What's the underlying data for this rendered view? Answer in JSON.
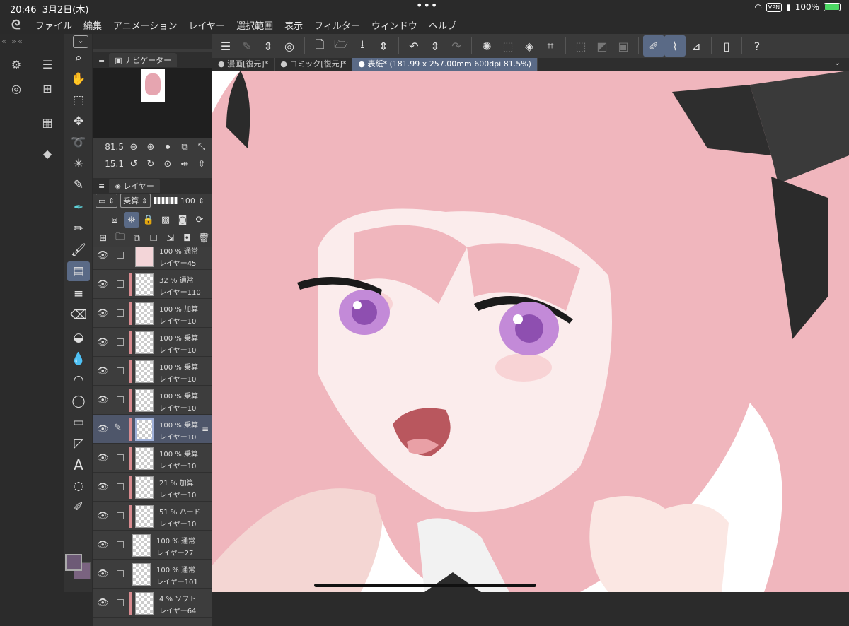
{
  "status": {
    "time": "20:46",
    "date": "3月2日(木)",
    "vpn": "VPN",
    "battery": "100%"
  },
  "menu": [
    "ファイル",
    "編集",
    "アニメーション",
    "レイヤー",
    "選択範囲",
    "表示",
    "フィルター",
    "ウィンドウ",
    "ヘルプ"
  ],
  "navigator": {
    "title": "ナビゲーター",
    "zoom": "81.5",
    "rotation": "15.1"
  },
  "layers_panel": {
    "title": "レイヤー",
    "blend_mode": "乗算",
    "opacity": "100"
  },
  "layers": [
    {
      "opacity": "100 %",
      "mode": "通常",
      "name": "レイヤー45",
      "selected": false,
      "pink": true
    },
    {
      "opacity": "32 %",
      "mode": "通常",
      "name": "レイヤー110",
      "selected": false,
      "pink": false
    },
    {
      "opacity": "100 %",
      "mode": "加算",
      "name": "レイヤー10",
      "selected": false,
      "pink": false
    },
    {
      "opacity": "100 %",
      "mode": "乗算",
      "name": "レイヤー10",
      "selected": false,
      "pink": false
    },
    {
      "opacity": "100 %",
      "mode": "乗算",
      "name": "レイヤー10",
      "selected": false,
      "pink": false
    },
    {
      "opacity": "100 %",
      "mode": "乗算",
      "name": "レイヤー10",
      "selected": false,
      "pink": false
    },
    {
      "opacity": "100 %",
      "mode": "乗算",
      "name": "レイヤー10",
      "selected": true,
      "pink": false
    },
    {
      "opacity": "100 %",
      "mode": "乗算",
      "name": "レイヤー10",
      "selected": false,
      "pink": false
    },
    {
      "opacity": "21 %",
      "mode": "加算",
      "name": "レイヤー10",
      "selected": false,
      "pink": false
    },
    {
      "opacity": "51 %",
      "mode": "ハード",
      "name": "レイヤー10",
      "selected": false,
      "pink": false
    },
    {
      "opacity": "100 %",
      "mode": "通常",
      "name": "レイヤー27",
      "selected": false,
      "pink": false
    },
    {
      "opacity": "100 %",
      "mode": "通常",
      "name": "レイヤー101",
      "selected": false,
      "pink": false
    },
    {
      "opacity": "4 %",
      "mode": "ソフト",
      "name": "レイヤー64",
      "selected": false,
      "pink": false
    }
  ],
  "tabs": [
    {
      "label": "漫画[復元]*",
      "active": false
    },
    {
      "label": "コミック[復元]*",
      "active": false
    },
    {
      "label": "表紙* (181.99 x 257.00mm 600dpi 81.5%)",
      "active": true
    }
  ],
  "colors": {
    "accent": "#5a6a86",
    "hair": "#f0b6bd",
    "eye": "#b06fd0",
    "ribbon": "#2b2b2b"
  }
}
